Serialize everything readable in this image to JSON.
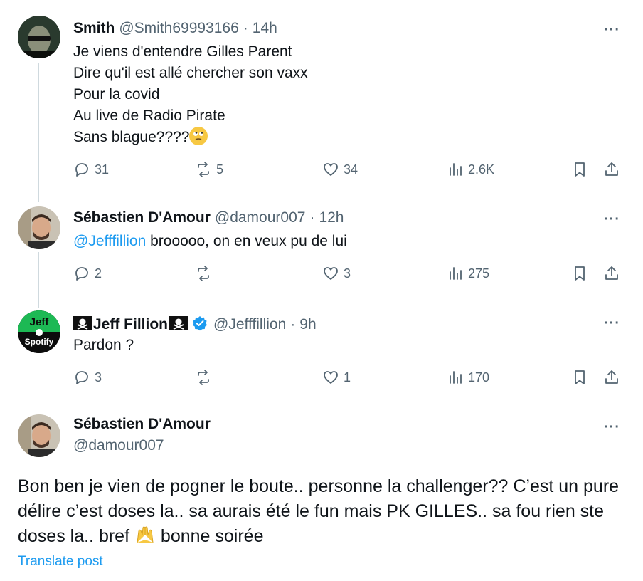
{
  "replies": [
    {
      "name": "Smith",
      "handle": "@Smith69993166",
      "time": "14h",
      "lines": [
        "Je viens d'entendre Gilles Parent",
        "Dire qu'il est allé chercher son vaxx",
        "Pour la covid",
        "Au live de Radio Pirate",
        "Sans blague????"
      ],
      "emoji": "face-with-rolling-eyes-emoji",
      "replies_count": "31",
      "reposts_count": "5",
      "likes_count": "34",
      "views_count": "2.6K"
    },
    {
      "name": "Sébastien D'Amour",
      "handle": "@damour007",
      "time": "12h",
      "mention": "@Jefffillion",
      "text": " brooooo, on en veux pu de lui",
      "replies_count": "2",
      "reposts_count": "",
      "likes_count": "3",
      "views_count": "275"
    },
    {
      "name": "Jeff Fillion",
      "name_decoration": "skull-and-crossbones-flag-emoji",
      "verified": true,
      "handle": "@Jefffillion",
      "time": "9h",
      "text": "Pardon ?",
      "avatar_text_top": "Jeff",
      "avatar_text_bottom": "Spotify",
      "replies_count": "3",
      "reposts_count": "",
      "likes_count": "1",
      "views_count": "170"
    }
  ],
  "main_post": {
    "name": "Sébastien D'Amour",
    "handle": "@damour007",
    "text_before_emoji": "Bon ben je vien de pogner le boute.. personne la challenger?? C’est un pure délire c’est doses la.. sa aurais été le fun mais PK GILLES.. sa fou rien ste doses la.. bref ",
    "emoji": "raising-hands-emoji",
    "text_after_emoji": " bonne soirée",
    "translate_label": "Translate post"
  },
  "more_label": "···",
  "colors": {
    "accent": "#1d9bf0",
    "secondary_text": "#536471",
    "thread_line": "#cfd9de",
    "verified_badge": "#1d9bf0"
  }
}
